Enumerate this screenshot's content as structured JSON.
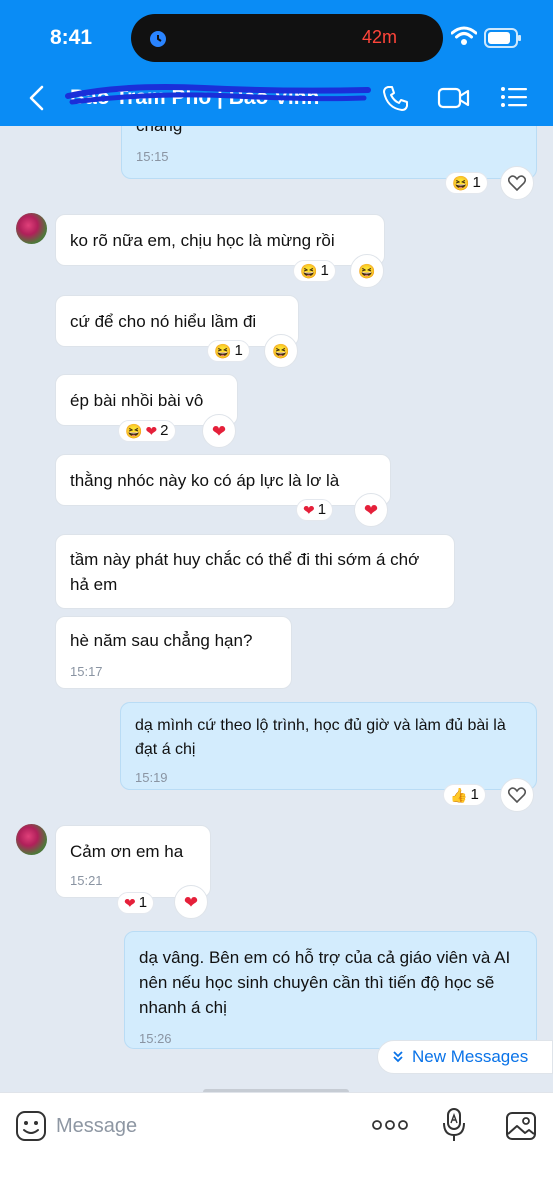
{
  "status_bar": {
    "time": "8:41",
    "island_timer": "42m"
  },
  "header": {
    "contact_name": "Bao Tram Pho | Bao Vinh"
  },
  "messages": [
    {
      "text": "chang",
      "time": "15:15",
      "reaction_count": "1"
    },
    {
      "text": "ko rõ nữa em, chịu học là mừng rồi",
      "reaction_count": "1"
    },
    {
      "text": "cứ để cho nó hiểu lầm đi",
      "reaction_count": "1"
    },
    {
      "text": "ép bài nhồi bài vô",
      "reaction_count": "2"
    },
    {
      "text": "thằng nhóc này ko có áp lực là lơ là",
      "reaction_count": "1"
    },
    {
      "text": "tầm này phát huy chắc có thể đi thi sớm á chớ hả em"
    },
    {
      "text": "hè năm sau chẳng hạn?",
      "time": "15:17"
    },
    {
      "text": "dạ mình cứ theo lộ trình, học đủ giờ và làm đủ bài là đạt á chị",
      "time": "15:19",
      "reaction_count": "1"
    },
    {
      "text": "Cảm ơn em ha",
      "time": "15:21",
      "reaction_count": "1"
    },
    {
      "text": "dạ vâng. Bên em có hỗ trợ của cả giáo viên và AI nên nếu học sinh chuyên cần thì tiến độ học sẽ nhanh á chị",
      "time": "15:26"
    }
  ],
  "new_messages_label": "New Messages",
  "composer": {
    "placeholder": "Message"
  },
  "colors": {
    "header": "#0a8cf5",
    "outgoing": "#d3ecfd",
    "incoming": "#ffffff",
    "accent": "#0a73e8"
  }
}
